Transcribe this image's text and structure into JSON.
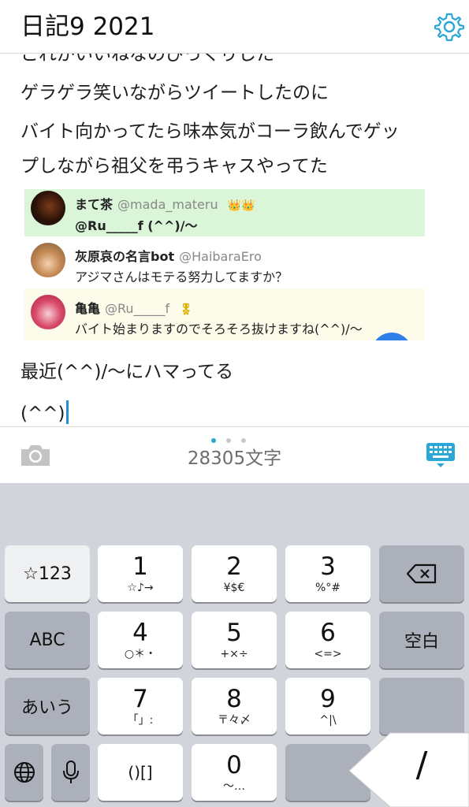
{
  "header": {
    "title": "日記9 2021"
  },
  "editor": {
    "lines": [
      "これがいいねなのびっくりした",
      "ゲラゲラ笑いながらツイートしたのに",
      "バイト向かってたら味本気がコーラ飲んでゲッ",
      "プしながら祖父を弔うキャスやってた",
      "最近(^^)/〜にハマってる",
      "(^^)"
    ]
  },
  "tweets": [
    {
      "name": "まて茶",
      "handle": "@mada_materu",
      "badge": "👑👑",
      "text": "@Ru_____f (^^)/〜"
    },
    {
      "name": "灰原哀の名言bot",
      "handle": "@HaibaraEro",
      "badge": "",
      "text": "アジマさんはモテる努力してますか？"
    },
    {
      "name": "亀亀",
      "handle": "@Ru_____f",
      "badge": "🎖",
      "text": "バイト始まりますのでそろそろ抜けますね(^^)/〜"
    }
  ],
  "toolbar": {
    "char_count": "28305文字",
    "page_dots": 3,
    "active_dot": 0
  },
  "keyboard": {
    "keys": {
      "sym": "☆123",
      "abc": "ABC",
      "kana": "あいう",
      "k1": {
        "main": "1",
        "sub": "☆♪→"
      },
      "k2": {
        "main": "2",
        "sub": "¥$€"
      },
      "k3": {
        "main": "3",
        "sub": "%°#"
      },
      "k4": {
        "main": "4",
        "sub": "○＊・"
      },
      "k5": {
        "main": "5",
        "sub": "+×÷"
      },
      "k6": {
        "main": "6",
        "sub": "<=>"
      },
      "k7": {
        "main": "7",
        "sub": "「」:"
      },
      "k8": {
        "main": "8",
        "sub": "〒々〆"
      },
      "k9": {
        "main": "9",
        "sub": "^|\\"
      },
      "k0": {
        "main": "0",
        "sub": "〜…"
      },
      "brackets": "()[]",
      "space": "空白",
      "popup": "/"
    }
  }
}
